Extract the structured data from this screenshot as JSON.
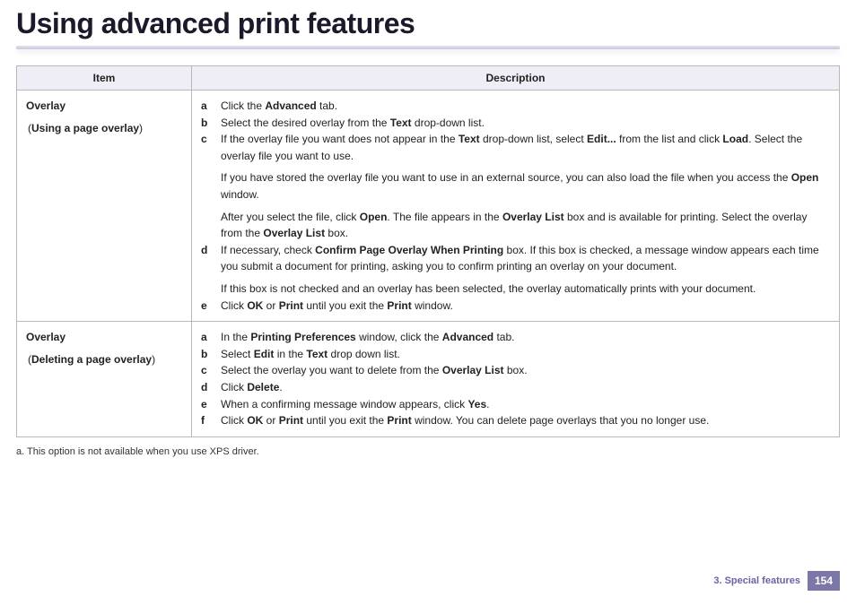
{
  "title": "Using advanced print features",
  "columns": {
    "item": "Item",
    "description": "Description"
  },
  "rows": [
    {
      "item_main": "Overlay",
      "item_sub_open": "(",
      "item_sub_bold": "Using a page overlay",
      "item_sub_close": ")",
      "steps": [
        {
          "letter": "a",
          "parts": [
            [
              "Click the ",
              0
            ],
            [
              "Advanced",
              1
            ],
            [
              " tab.",
              0
            ]
          ]
        },
        {
          "letter": "b",
          "parts": [
            [
              "Select the desired overlay from the ",
              0
            ],
            [
              "Text",
              1
            ],
            [
              " drop-down list.",
              0
            ]
          ]
        },
        {
          "letter": "c",
          "parts": [
            [
              "If the overlay file you want does not appear in the ",
              0
            ],
            [
              "Text",
              1
            ],
            [
              " drop-down list, select ",
              0
            ],
            [
              "Edit...",
              1
            ],
            [
              " from the list and click ",
              0
            ],
            [
              "Load",
              1
            ],
            [
              ". Select the overlay file you want to use.",
              0
            ]
          ],
          "extra": [
            [
              [
                "If you have stored the overlay file you want to use in an external source, you can also load the file when you access the ",
                0
              ],
              [
                "Open",
                1
              ],
              [
                " window.",
                0
              ]
            ],
            [
              [
                "After you select the file, click ",
                0
              ],
              [
                "Open",
                1
              ],
              [
                ". The file appears in the ",
                0
              ],
              [
                "Overlay List",
                1
              ],
              [
                " box and is available for printing. Select the overlay from the ",
                0
              ],
              [
                "Overlay List",
                1
              ],
              [
                " box.",
                0
              ]
            ]
          ]
        },
        {
          "letter": "d",
          "parts": [
            [
              "If necessary, check ",
              0
            ],
            [
              "Confirm Page Overlay When Printing",
              1
            ],
            [
              " box. If this box is checked, a message window appears each time you submit a document for printing, asking you to confirm printing an overlay on your document.",
              0
            ]
          ],
          "extra": [
            [
              [
                "If this box is not checked and an overlay has been selected, the overlay automatically prints with your document.",
                0
              ]
            ]
          ]
        },
        {
          "letter": "e",
          "parts": [
            [
              "Click ",
              0
            ],
            [
              "OK",
              1
            ],
            [
              " or ",
              0
            ],
            [
              "Print",
              1
            ],
            [
              " until you exit the ",
              0
            ],
            [
              "Print",
              1
            ],
            [
              " window.",
              0
            ]
          ]
        }
      ]
    },
    {
      "item_main": "Overlay",
      "item_sub_open": "(",
      "item_sub_bold": "Deleting a page overlay",
      "item_sub_close": ")",
      "steps": [
        {
          "letter": "a",
          "parts": [
            [
              "In the ",
              0
            ],
            [
              "Printing Preferences",
              1
            ],
            [
              " window, click the ",
              0
            ],
            [
              "Advanced",
              1
            ],
            [
              " tab.",
              0
            ]
          ]
        },
        {
          "letter": "b",
          "parts": [
            [
              "Select ",
              0
            ],
            [
              "Edit",
              1
            ],
            [
              " in the ",
              0
            ],
            [
              "Text",
              1
            ],
            [
              " drop down list.",
              0
            ]
          ]
        },
        {
          "letter": "c",
          "parts": [
            [
              "Select the overlay you want to delete from the ",
              0
            ],
            [
              "Overlay List",
              1
            ],
            [
              " box.",
              0
            ]
          ]
        },
        {
          "letter": "d",
          "parts": [
            [
              "Click ",
              0
            ],
            [
              "Delete",
              1
            ],
            [
              ".",
              0
            ]
          ]
        },
        {
          "letter": "e",
          "parts": [
            [
              "When a confirming message window appears, click ",
              0
            ],
            [
              "Yes",
              1
            ],
            [
              ".",
              0
            ]
          ]
        },
        {
          "letter": "f",
          "parts": [
            [
              "Click ",
              0
            ],
            [
              "OK",
              1
            ],
            [
              " or ",
              0
            ],
            [
              "Print",
              1
            ],
            [
              " until you exit the ",
              0
            ],
            [
              "Print",
              1
            ],
            [
              " window. You can delete page overlays that you no longer use.",
              0
            ]
          ]
        }
      ]
    }
  ],
  "footnote": "a.  This option is not available when you use XPS driver.",
  "footer": {
    "chapter": "3.  Special features",
    "page": "154"
  }
}
